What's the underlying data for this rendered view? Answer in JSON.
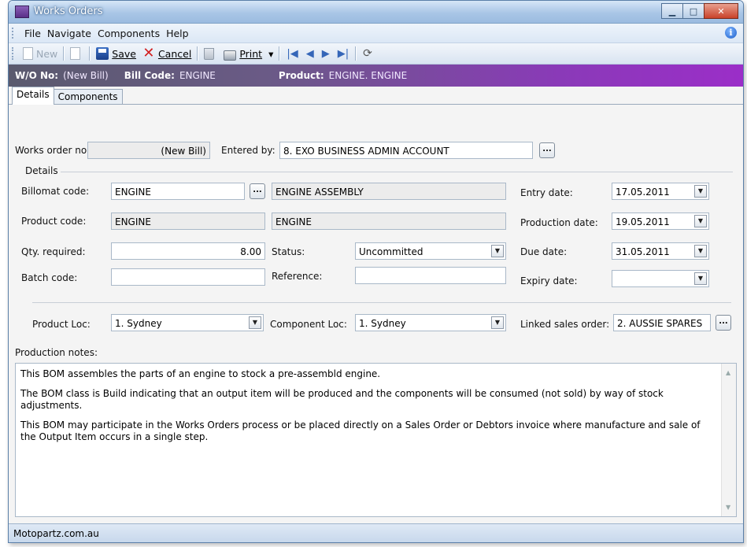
{
  "window": {
    "title": "Works Orders",
    "minimize_glyph": "▁",
    "maximize_glyph": "□",
    "close_glyph": "✕"
  },
  "menu": {
    "items": [
      "File",
      "Navigate",
      "Components",
      "Help"
    ],
    "info_glyph": "i"
  },
  "toolbar": {
    "new_label": "New",
    "save_label": "Save",
    "cancel_label": "Cancel",
    "print_label": "Print",
    "print_dropdown": "▾",
    "cancel_glyph": "✕",
    "nav_first": "|◀",
    "nav_prev": "◀",
    "nav_next": "▶",
    "nav_last": "▶|",
    "refresh_glyph": "⟳"
  },
  "header": {
    "wo_label": "W/O No:",
    "wo_value": "(New Bill)",
    "bill_label": "Bill Code:",
    "bill_value": "ENGINE",
    "product_label": "Product:",
    "product_value": "ENGINE. ENGINE"
  },
  "tabs": [
    "Details",
    "Components"
  ],
  "form": {
    "works_order_no_label": "Works order no:",
    "works_order_no_value": "(New Bill)",
    "entered_by_label": "Entered by:",
    "entered_by_value": "8. EXO BUSINESS ADMIN ACCOUNT",
    "details_group_label": "Details",
    "billomat_code_label": "Billomat code:",
    "billomat_code_value": "ENGINE",
    "billomat_desc": "ENGINE ASSEMBLY",
    "product_code_label": "Product code:",
    "product_code_value": "ENGINE",
    "product_desc": "ENGINE",
    "qty_required_label": "Qty. required:",
    "qty_required_value": "8.00",
    "status_label": "Status:",
    "status_value": "Uncommitted",
    "batch_code_label": "Batch code:",
    "batch_code_value": "",
    "reference_label": "Reference:",
    "reference_value": "",
    "entry_date_label": "Entry date:",
    "entry_date_value": "17.05.2011",
    "production_date_label": "Production date:",
    "production_date_value": "19.05.2011",
    "due_date_label": "Due date:",
    "due_date_value": "31.05.2011",
    "expiry_date_label": "Expiry date:",
    "expiry_date_value": "",
    "product_loc_label": "Product Loc:",
    "product_loc_value": "1. Sydney",
    "component_loc_label": "Component Loc:",
    "component_loc_value": "1. Sydney",
    "linked_sales_order_label": "Linked sales order:",
    "linked_sales_order_value": "2. AUSSIE SPARES",
    "ellipsis": "...",
    "dropdown_arrow": "▼"
  },
  "notes": {
    "label": "Production notes:",
    "paragraphs": [
      "This BOM assembles the parts of an engine to stock a pre-assembld engine.",
      "The BOM class is Build indicating that an output item will be produced and the components will be consumed (not sold) by way of stock adjustments.",
      "This BOM may participate in the Works Orders process or be placed directly on a Sales Order or Debtors invoice where manufacture and sale of the Output Item occurs in a single step."
    ],
    "scroll_up": "▲",
    "scroll_down": "▼"
  },
  "status_bar": {
    "text": "Motopartz.com.au"
  }
}
